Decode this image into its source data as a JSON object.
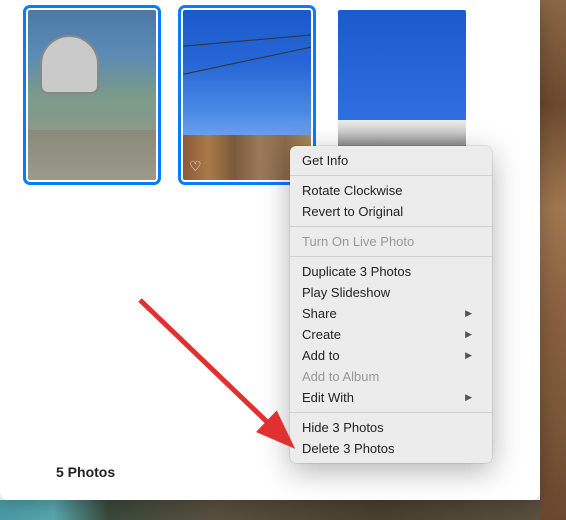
{
  "footer": {
    "count_label": "5 Photos"
  },
  "photos": [
    {
      "selected": true,
      "favorite": false
    },
    {
      "selected": true,
      "favorite": true
    },
    {
      "selected": false,
      "favorite": false
    }
  ],
  "context_menu": {
    "items": [
      {
        "label": "Get Info",
        "enabled": true,
        "submenu": false
      },
      {
        "divider": true
      },
      {
        "label": "Rotate Clockwise",
        "enabled": true,
        "submenu": false
      },
      {
        "label": "Revert to Original",
        "enabled": true,
        "submenu": false
      },
      {
        "divider": true
      },
      {
        "label": "Turn On Live Photo",
        "enabled": false,
        "submenu": false
      },
      {
        "divider": true
      },
      {
        "label": "Duplicate 3 Photos",
        "enabled": true,
        "submenu": false
      },
      {
        "label": "Play Slideshow",
        "enabled": true,
        "submenu": false
      },
      {
        "label": "Share",
        "enabled": true,
        "submenu": true
      },
      {
        "label": "Create",
        "enabled": true,
        "submenu": true
      },
      {
        "label": "Add to",
        "enabled": true,
        "submenu": true
      },
      {
        "label": "Add to Album",
        "enabled": false,
        "submenu": false
      },
      {
        "label": "Edit With",
        "enabled": true,
        "submenu": true
      },
      {
        "divider": true
      },
      {
        "label": "Hide 3 Photos",
        "enabled": true,
        "submenu": false
      },
      {
        "label": "Delete 3 Photos",
        "enabled": true,
        "submenu": false
      }
    ]
  },
  "annotation": {
    "arrow_color": "#e03030"
  }
}
